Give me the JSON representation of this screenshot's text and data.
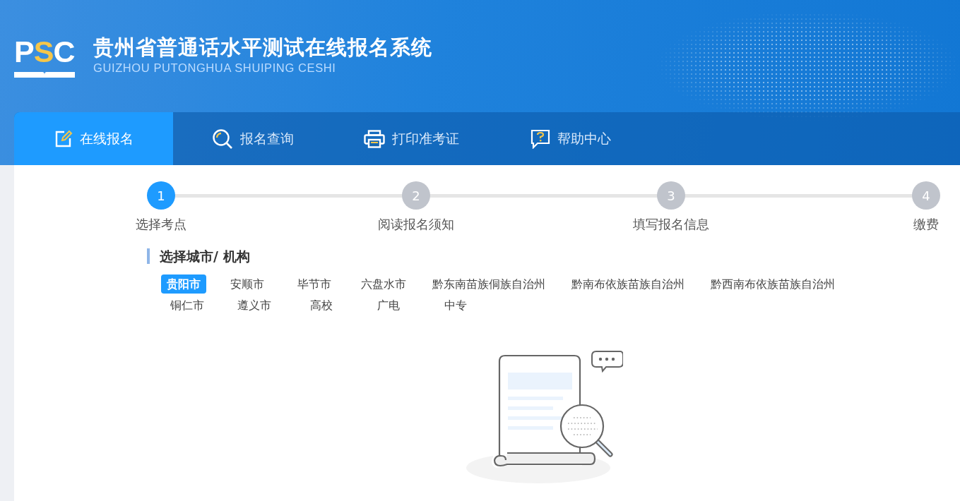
{
  "logo": {
    "letters": [
      {
        "text": "P",
        "color": "#ffffff"
      },
      {
        "text": "S",
        "color": "#f6c649"
      },
      {
        "text": "C",
        "color": "#ffffff"
      }
    ]
  },
  "site": {
    "title": "贵州省普通话水平测试在线报名系统",
    "subtitle": "GUIZHOU PUTONGHUA SHUIPING CESHI"
  },
  "nav": [
    {
      "label": "在线报名",
      "kind": "edit",
      "selected": true
    },
    {
      "label": "报名查询",
      "kind": "search",
      "selected": false
    },
    {
      "label": "打印准考证",
      "kind": "print",
      "selected": false
    },
    {
      "label": "帮助中心",
      "kind": "help",
      "selected": false
    }
  ],
  "steps": [
    {
      "number": "1",
      "label": "选择考点",
      "active": true
    },
    {
      "number": "2",
      "label": "阅读报名须知",
      "active": false
    },
    {
      "number": "3",
      "label": "填写报名信息",
      "active": false
    },
    {
      "number": "4",
      "label": "缴费",
      "active": false
    }
  ],
  "section": {
    "title": "选择城市/ 机构"
  },
  "cities": [
    {
      "label": "贵阳市",
      "selected": true
    },
    {
      "label": "安顺市",
      "selected": false
    },
    {
      "label": "毕节市",
      "selected": false
    },
    {
      "label": "六盘水市",
      "selected": false
    },
    {
      "label": "黔东南苗族侗族自治州",
      "selected": false
    },
    {
      "label": "黔南布依族苗族自治州",
      "selected": false
    },
    {
      "label": "黔西南布依族苗族自治州",
      "selected": false
    },
    {
      "label": "铜仁市",
      "selected": false
    },
    {
      "label": "遵义市",
      "selected": false
    },
    {
      "label": "高校",
      "selected": false
    },
    {
      "label": "广电",
      "selected": false
    },
    {
      "label": "中专",
      "selected": false
    }
  ]
}
